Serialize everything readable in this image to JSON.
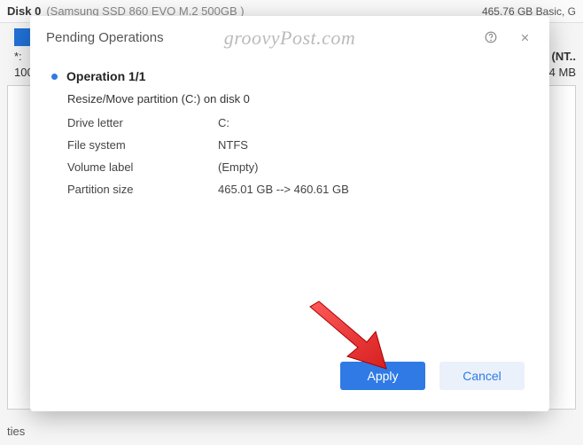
{
  "background": {
    "disk_label": "Disk 0",
    "disk_model": "(Samsung SSD 860 EVO M.2 500GB )",
    "disk_size": "465.76 GB Basic, G",
    "row_star": "*:",
    "row_100": "100",
    "right1": "(NT..",
    "right2": "4 MB",
    "footer": "ties"
  },
  "modal": {
    "title": "Pending Operations",
    "watermark": "groovyPost.com",
    "operation_title": "Operation 1/1",
    "operation_desc": "Resize/Move partition (C:) on disk 0",
    "rows": {
      "drive_letter_label": "Drive letter",
      "drive_letter_value": "C:",
      "file_system_label": "File system",
      "file_system_value": "NTFS",
      "volume_label_label": "Volume label",
      "volume_label_value": "(Empty)",
      "partition_size_label": "Partition size",
      "partition_size_value": "465.01 GB --> 460.61 GB"
    },
    "buttons": {
      "apply": "Apply",
      "cancel": "Cancel"
    }
  }
}
